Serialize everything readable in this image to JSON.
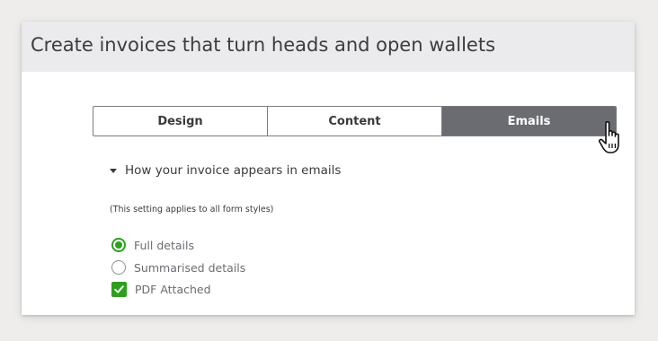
{
  "header": {
    "title": "Create invoices that turn heads and open wallets"
  },
  "tabs": [
    {
      "label": "Design",
      "active": false
    },
    {
      "label": "Content",
      "active": false
    },
    {
      "label": "Emails",
      "active": true
    }
  ],
  "section": {
    "title": "How your invoice appears in emails",
    "expanded": true,
    "note": "(This setting applies to all form styles)"
  },
  "email_format": {
    "options": [
      {
        "label": "Full details",
        "selected": true
      },
      {
        "label": "Summarised details",
        "selected": false
      }
    ]
  },
  "pdf_attached": {
    "label": "PDF Attached",
    "checked": true
  },
  "colors": {
    "accent_green": "#2ca01c",
    "active_tab": "#6b6c72",
    "header_bg": "#ebebed"
  },
  "icons": {
    "caret": "caret-down-icon",
    "cursor": "hand-pointer-icon",
    "check": "checkmark-icon"
  }
}
